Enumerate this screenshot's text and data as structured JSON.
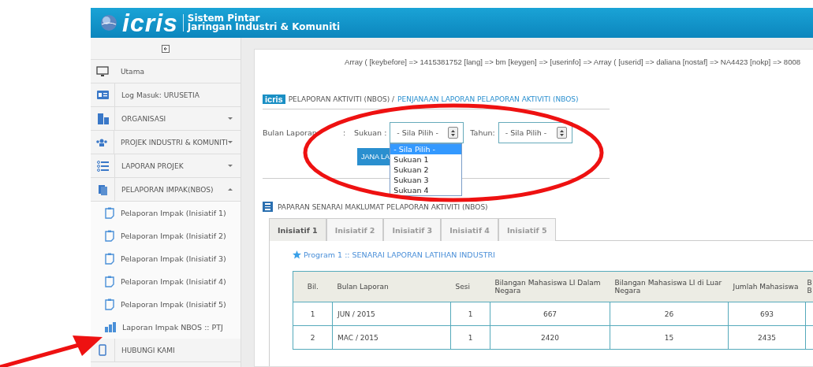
{
  "header": {
    "logo": "icris",
    "title_line_1": "Sistem Pintar",
    "title_line_2": "Jaringan Industri & Komuniti"
  },
  "sidebar": {
    "items": [
      {
        "label": "Utama",
        "kind": "monitor"
      },
      {
        "label": "Log Masuk: URUSETIA",
        "kind": "card"
      },
      {
        "label": "ORGANISASI",
        "kind": "building",
        "expanded": false
      },
      {
        "label": "PROJEK INDUSTRI & KOMUNITI",
        "kind": "people",
        "expanded": false
      },
      {
        "label": "LAPORAN PROJEK",
        "kind": "list",
        "expanded": false
      },
      {
        "label": "PELAPORAN IMPAK(NBOS)",
        "kind": "clipboard",
        "expanded": true,
        "children": [
          {
            "label": "Pelaporan Impak (Inisiatif 1)",
            "kind": "doc"
          },
          {
            "label": "Pelaporan Impak (Inisiatif 2)",
            "kind": "doc"
          },
          {
            "label": "Pelaporan Impak (Inisiatif 3)",
            "kind": "doc"
          },
          {
            "label": "Pelaporan Impak (Inisiatif 4)",
            "kind": "doc"
          },
          {
            "label": "Pelaporan Impak (Inisiatif 5)",
            "kind": "doc"
          },
          {
            "label": "Laporan Impak NBOS :: PTJ",
            "kind": "chart"
          }
        ]
      },
      {
        "label": "HUBUNGI KAMI",
        "kind": "phone"
      }
    ]
  },
  "debug_text": "Array ( [keybefore] => 1415381752 [lang] => bm [keygen] => [userinfo] => Array ( [userid] => daliana [nostaf] => NA4423 [nokp] => 8008",
  "breadcrumb": {
    "badge": "icris",
    "section": "PELAPORAN AKTIVITI (NBOS) /",
    "page": "PENJANAAN LAPORAN PELAPORAN AKTIVITI (NBOS)"
  },
  "form": {
    "label": "Bulan Laporan",
    "colon": ":",
    "sukuan_label": "Sukuan :",
    "sukuan_value": "- Sila Pilih -",
    "tahun_label": "Tahun:",
    "tahun_value": "- Sila Pilih -",
    "button": "JANA LA",
    "options": [
      {
        "label": "- Sila Pilih -",
        "selected": true
      },
      {
        "label": "Sukuan 1",
        "selected": false
      },
      {
        "label": "Sukuan 2",
        "selected": false
      },
      {
        "label": "Sukuan 3",
        "selected": false
      },
      {
        "label": "Sukuan 4",
        "selected": false
      }
    ]
  },
  "list_title": "PAPARAN SENARAI MAKLUMAT PELAPORAN AKTIVITI (NBOS)",
  "tabs": [
    {
      "label": "Inisiatif 1",
      "selected": true
    },
    {
      "label": "Inisiatif 2",
      "selected": false
    },
    {
      "label": "Inisiatif 3",
      "selected": false
    },
    {
      "label": "Inisiatif 4",
      "selected": false
    },
    {
      "label": "Inisiatif 5",
      "selected": false
    }
  ],
  "program_title": "Program 1 :: SENARAI LAPORAN LATIHAN INDUSTRI",
  "table": {
    "columns": [
      "Bil.",
      "Bulan Laporan",
      "Sesi",
      "Bilangan Mahasiswa LI Dalam Negara",
      "Bilangan Mahasiswa LI di Luar Negara",
      "Jumlah Mahasiswa",
      "B B"
    ],
    "rows": [
      [
        "1",
        "JUN / 2015",
        "1",
        "667",
        "26",
        "693"
      ],
      [
        "2",
        "MAC / 2015",
        "1",
        "2420",
        "15",
        "2435"
      ]
    ]
  }
}
